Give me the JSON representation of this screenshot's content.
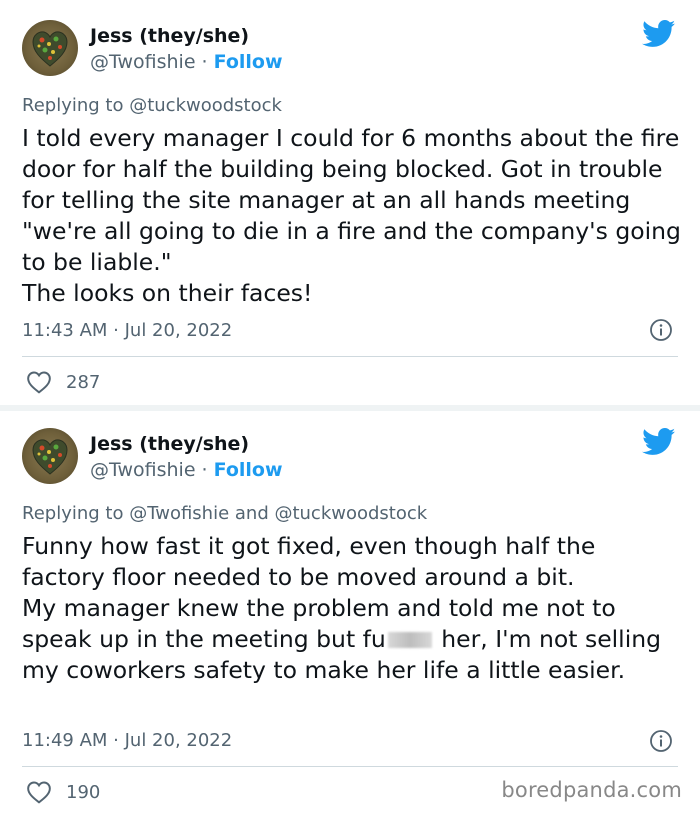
{
  "tweets": [
    {
      "author_name": "Jess (they/she)",
      "handle": "@Twofishie",
      "separator": " · ",
      "follow_label": "Follow",
      "reply_prefix": "Replying to ",
      "reply_mentions": "@tuckwoodstock",
      "body": "I told every manager I could for 6 months about the fire door for half the building being blocked. Got in trouble for telling the site manager at an all hands meeting \"we're all going to die in a fire and the company's going to be liable.\"\nThe looks on their faces!",
      "timestamp": "11:43 AM · Jul 20, 2022",
      "likes": "287"
    },
    {
      "author_name": "Jess (they/she)",
      "handle": "@Twofishie",
      "separator": " · ",
      "follow_label": "Follow",
      "reply_prefix": "Replying to ",
      "reply_mentions": "@Twofishie and @tuckwoodstock",
      "body_part1": "Funny how fast it got fixed, even though half the factory floor needed to be moved around a bit.\nMy manager knew the problem and told me not to speak up in the meeting but fu",
      "body_part2": " her, I'm not selling my coworkers safety to make her life a little easier.",
      "timestamp": "11:49 AM · Jul 20, 2022",
      "likes": "190"
    }
  ],
  "watermark": "boredpanda.com",
  "colors": {
    "accent": "#1d9bf0",
    "secondary_text": "#536471",
    "primary_text": "#0f1419",
    "separator": "#eff3f4"
  },
  "icons": [
    "twitter-bird-icon",
    "info-icon",
    "heart-icon",
    "avatar"
  ]
}
